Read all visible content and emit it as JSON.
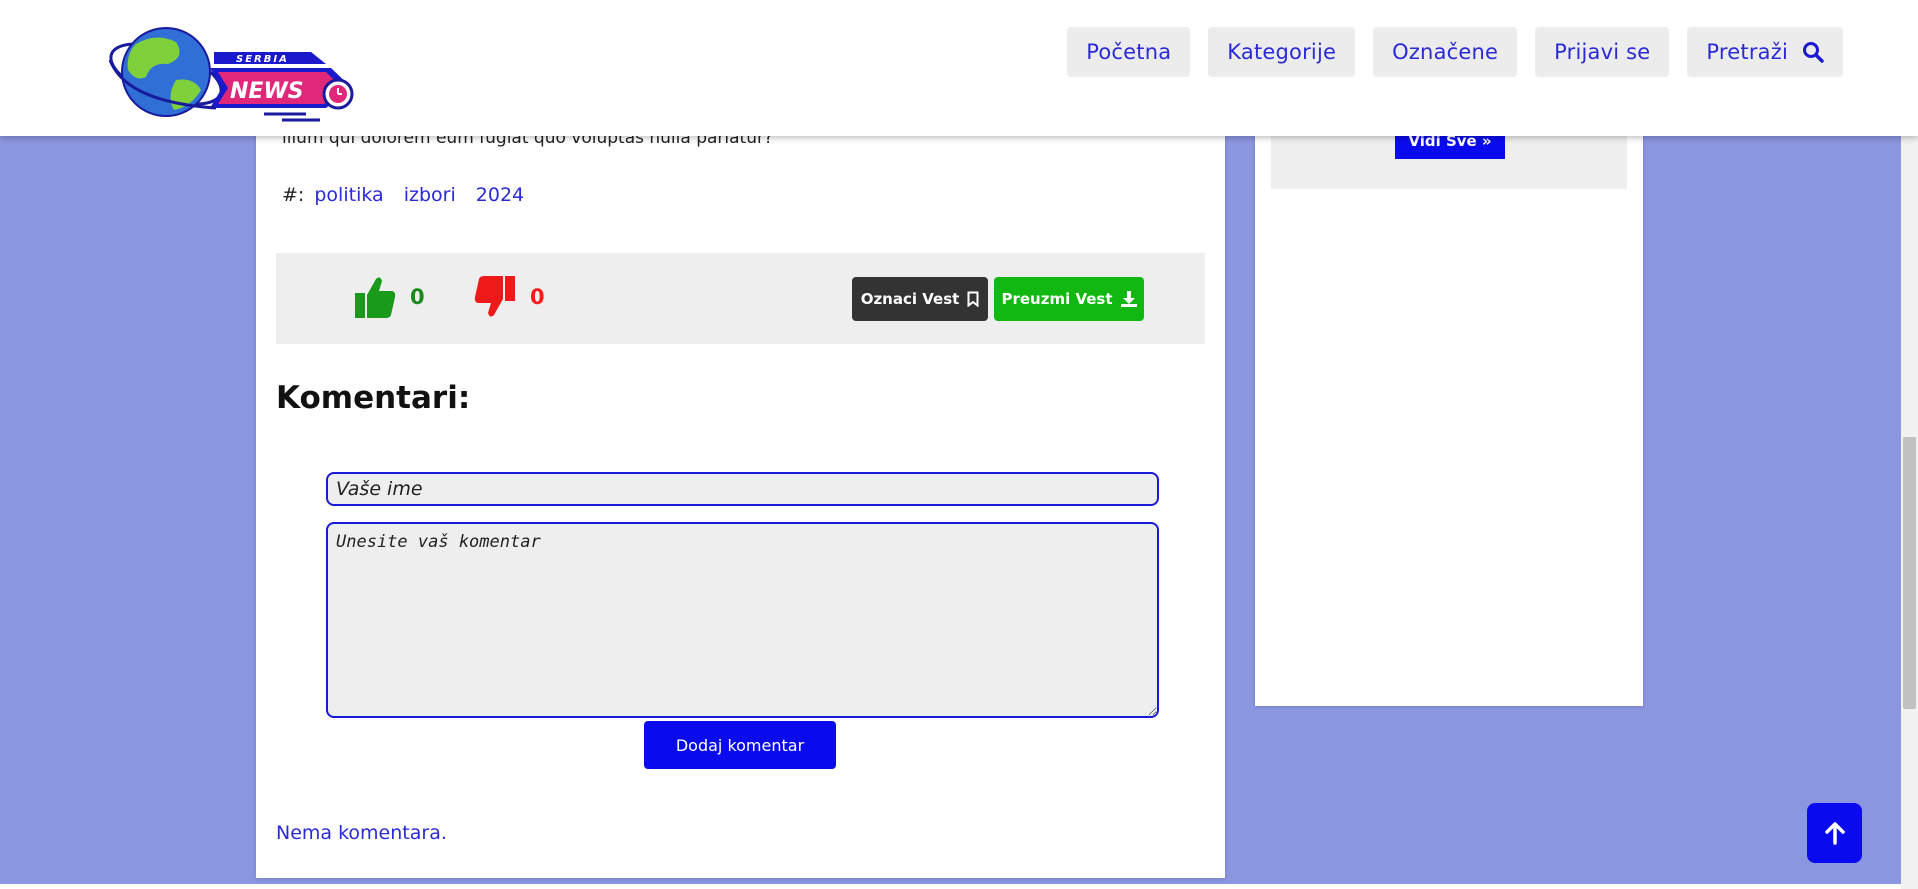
{
  "logo": {
    "brand_top": "SERBIA",
    "brand_main": "NEWS"
  },
  "nav": {
    "items": [
      "Početna",
      "Kategorije",
      "Označene",
      "Prijavi se",
      "Pretraži"
    ]
  },
  "article": {
    "body_tail": "illum qui dolorem eum fugiat quo voluptas nulla pariatur?",
    "tags_label": "#:",
    "tags": [
      "politika",
      "izbori",
      "2024"
    ],
    "likes": "0",
    "dislikes": "0",
    "mark_label": "Oznaci Vest",
    "download_label": "Preuzmi Vest"
  },
  "comments": {
    "title": "Komentari:",
    "name_placeholder": "Vaše ime",
    "comment_placeholder": "Unesite vaš komentar",
    "submit_label": "Dodaj komentar",
    "empty_text": "Nema komentara."
  },
  "sidebar": {
    "see_all_label": "Vidi Sve »"
  },
  "colors": {
    "background": "#8b96e0",
    "accent": "#0a0aee",
    "like": "#1a8a1a",
    "dislike": "#ff1a1a",
    "download": "#11b811"
  },
  "icons": [
    "search-icon",
    "thumbs-up-icon",
    "thumbs-down-icon",
    "bookmark-icon",
    "download-icon",
    "arrow-up-icon",
    "clock-icon",
    "globe-icon"
  ]
}
